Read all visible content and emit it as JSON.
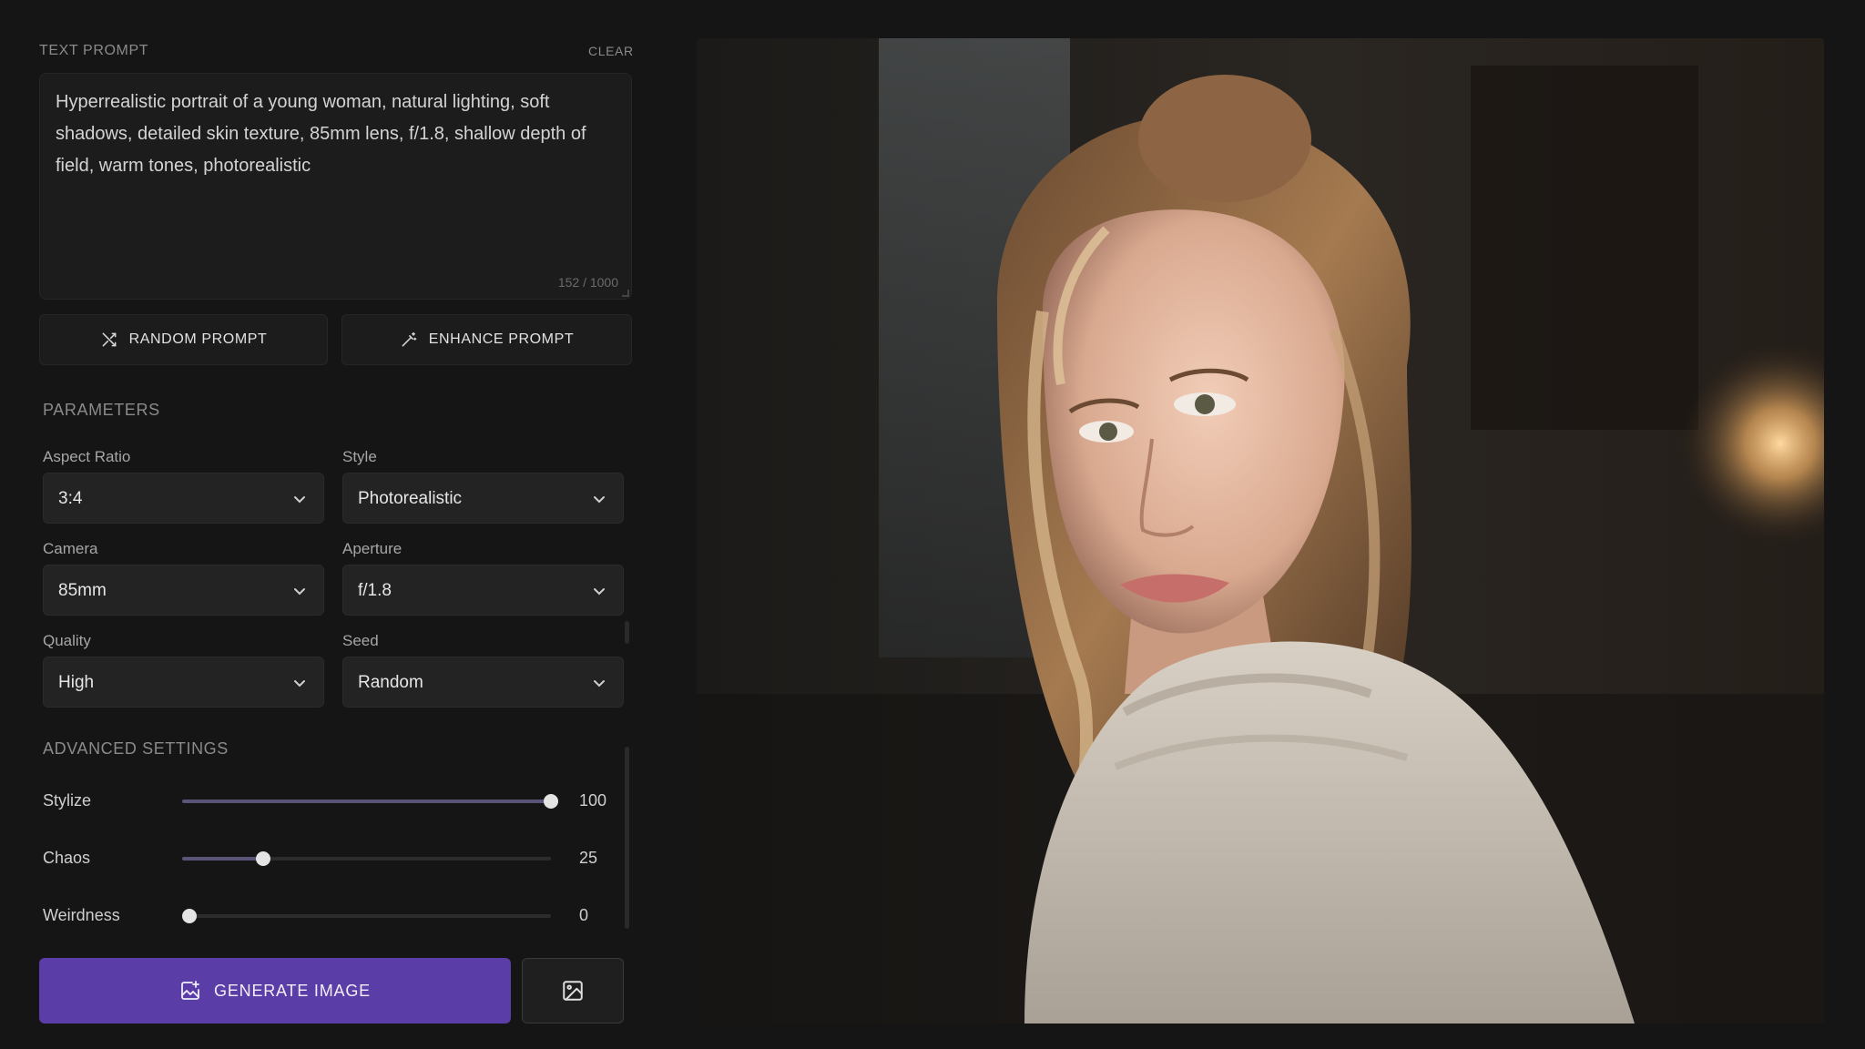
{
  "prompt": {
    "section_label": "TEXT PROMPT",
    "clear_label": "CLEAR",
    "text": "Hyperrealistic portrait of a young woman, natural lighting, soft shadows, detailed skin texture, 85mm lens, f/1.8, shallow depth of field, warm tones, photorealistic",
    "char_count": "152 / 1000"
  },
  "actions": {
    "random_prompt": "RANDOM PROMPT",
    "enhance_prompt": "ENHANCE PROMPT"
  },
  "parameters": {
    "section_label": "PARAMETERS",
    "fields": [
      {
        "label": "Aspect Ratio",
        "value": "3:4"
      },
      {
        "label": "Style",
        "value": "Photorealistic"
      },
      {
        "label": "Camera",
        "value": "85mm"
      },
      {
        "label": "Aperture",
        "value": "f/1.8"
      },
      {
        "label": "Quality",
        "value": "High"
      },
      {
        "label": "Seed",
        "value": "Random"
      }
    ]
  },
  "advanced": {
    "section_label": "ADVANCED SETTINGS",
    "sliders": [
      {
        "label": "Stylize",
        "value": "100",
        "fraction": 1.0
      },
      {
        "label": "Chaos",
        "value": "25",
        "fraction": 0.22
      },
      {
        "label": "Weirdness",
        "value": "0",
        "fraction": 0.0
      }
    ]
  },
  "generate": {
    "label": "GENERATE IMAGE"
  },
  "colors": {
    "accent": "#5a3da6",
    "background": "#151515",
    "surface": "#1c1c1c"
  },
  "icons": {
    "random": "shuffle-icon",
    "enhance": "magic-wand-icon",
    "generate": "image-sparkle-icon",
    "gallery": "image-icon",
    "select": "chevron-down-icon"
  }
}
